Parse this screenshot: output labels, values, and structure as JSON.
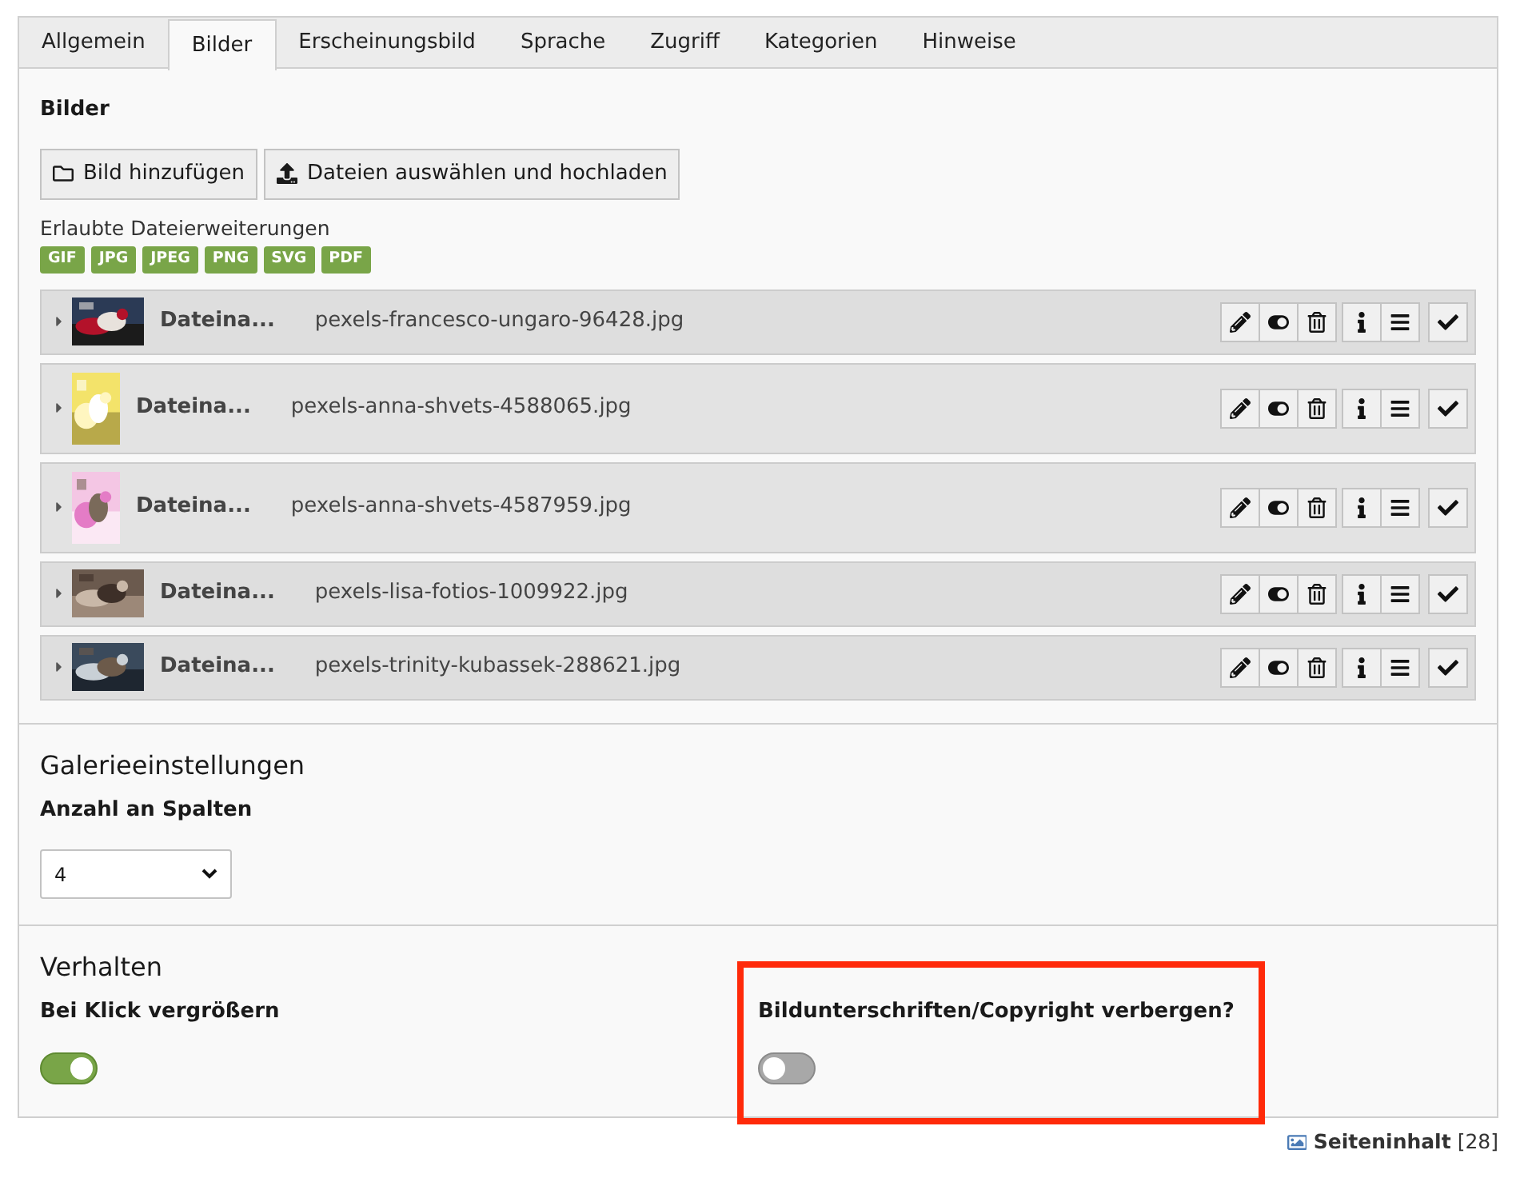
{
  "tabs": [
    {
      "label": "Allgemein",
      "selected": false
    },
    {
      "label": "Bilder",
      "selected": true
    },
    {
      "label": "Erscheinungsbild",
      "selected": false
    },
    {
      "label": "Sprache",
      "selected": false
    },
    {
      "label": "Zugriff",
      "selected": false
    },
    {
      "label": "Kategorien",
      "selected": false
    },
    {
      "label": "Hinweise",
      "selected": false
    }
  ],
  "images_section": {
    "title": "Bilder",
    "buttons": [
      "Bild hinzufügen",
      "Dateien auswählen und hochladen"
    ],
    "extensions_label": "Erlaubte Dateierweiterungen",
    "extensions": [
      "GIF",
      "JPG",
      "JPEG",
      "PNG",
      "SVG",
      "PDF"
    ],
    "files": [
      {
        "kind": "landscape",
        "label": "Dateina...",
        "filename": "pexels-francesco-ungaro-96428.jpg",
        "expanded": false
      },
      {
        "kind": "portrait",
        "label": "Dateina...",
        "filename": "pexels-anna-shvets-4588065.jpg",
        "expanded": false
      },
      {
        "kind": "portrait",
        "label": "Dateina...",
        "filename": "pexels-anna-shvets-4587959.jpg",
        "expanded": false
      },
      {
        "kind": "landscape",
        "label": "Dateina...",
        "filename": "pexels-lisa-fotios-1009922.jpg",
        "expanded": false
      },
      {
        "kind": "landscape",
        "label": "Dateina...",
        "filename": "pexels-trinity-kubassek-288621.jpg",
        "expanded": false
      }
    ]
  },
  "gallery": {
    "title": "Galerieeinstellungen",
    "columns_label": "Anzahl an Spalten",
    "columns_value": "4"
  },
  "behavior": {
    "title": "Verhalten",
    "toggles": [
      {
        "label": "Bei Klick vergrößern",
        "on": true,
        "highlighted": false
      },
      {
        "label": "Bildunterschriften/Copyright verbergen?",
        "on": false,
        "highlighted": true
      }
    ]
  },
  "footer": {
    "record_type": "Seiteninhalt",
    "record_id": "[28]"
  }
}
